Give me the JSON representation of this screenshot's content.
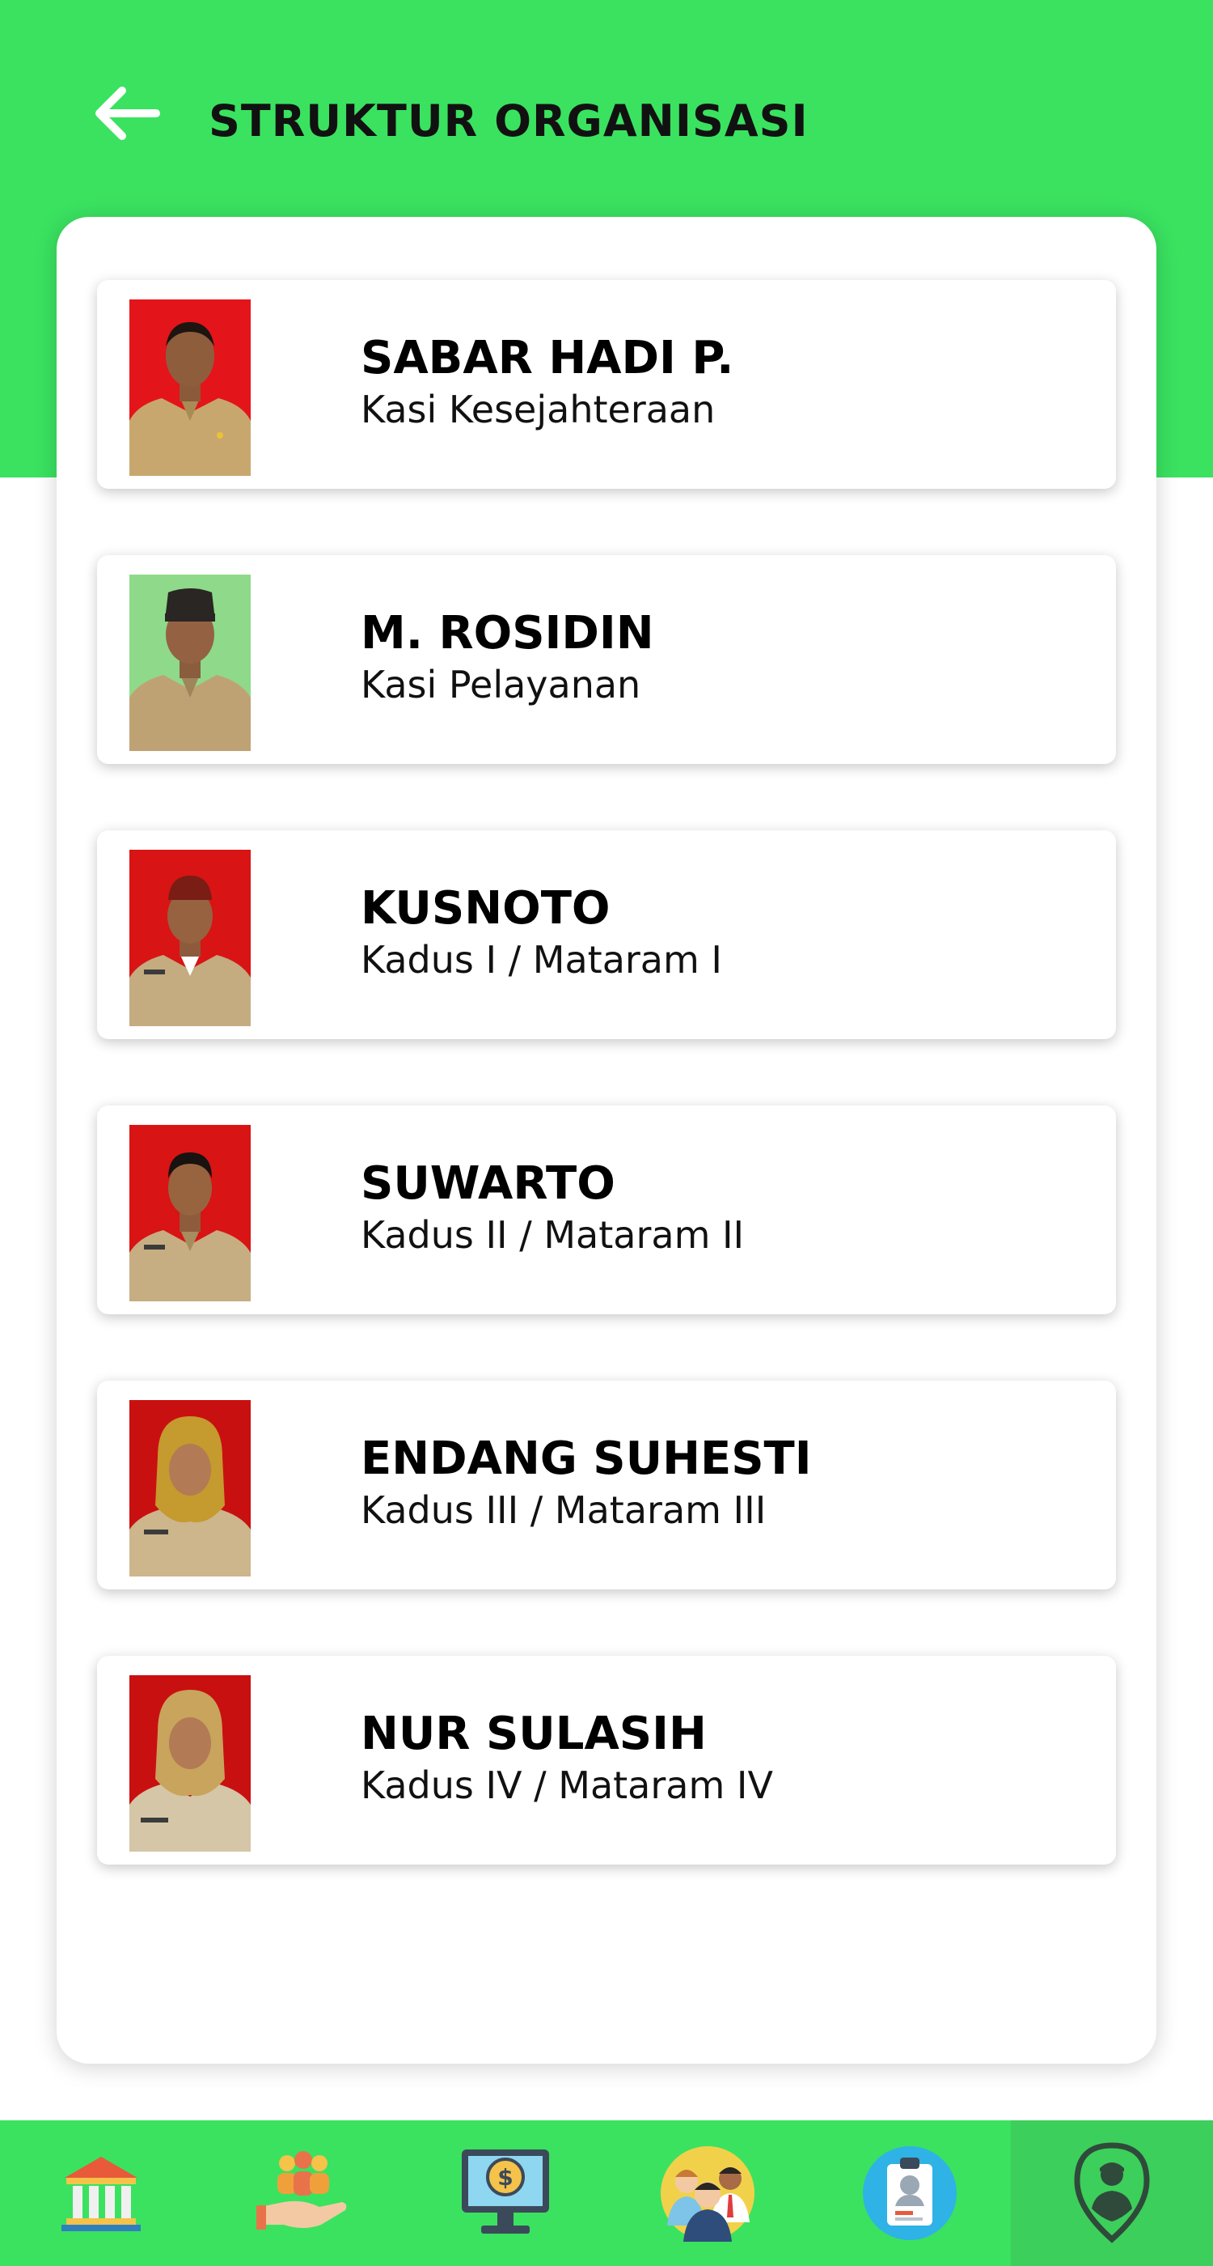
{
  "header": {
    "title": "STRUKTUR ORGANISASI",
    "back_icon": "arrow-left-icon"
  },
  "colors": {
    "brand_green": "#3ae260",
    "active_nav": "#3ccf5b",
    "card_bg": "#ffffff"
  },
  "people": [
    {
      "name": "SABAR HADI P.",
      "role": "Kasi Kesejahteraan",
      "photo_bg": "#e3151a"
    },
    {
      "name": "M. ROSIDIN",
      "role": "Kasi Pelayanan",
      "photo_bg": "#8fd98a"
    },
    {
      "name": "KUSNOTO",
      "role": "Kadus I / Mataram I",
      "photo_bg": "#d81414"
    },
    {
      "name": "SUWARTO",
      "role": "Kadus II / Mataram II",
      "photo_bg": "#d81414"
    },
    {
      "name": "ENDANG SUHESTI",
      "role": "Kadus III / Mataram III",
      "photo_bg": "#c91010"
    },
    {
      "name": "NUR SULASIH",
      "role": "Kadus IV / Mataram IV",
      "photo_bg": "#c91010"
    }
  ],
  "nav": {
    "items": [
      {
        "icon": "government-building-icon"
      },
      {
        "icon": "community-hand-icon"
      },
      {
        "icon": "finance-monitor-icon"
      },
      {
        "icon": "people-group-icon"
      },
      {
        "icon": "id-clipboard-icon"
      },
      {
        "icon": "user-location-pin-icon"
      }
    ],
    "active_index": 5
  }
}
